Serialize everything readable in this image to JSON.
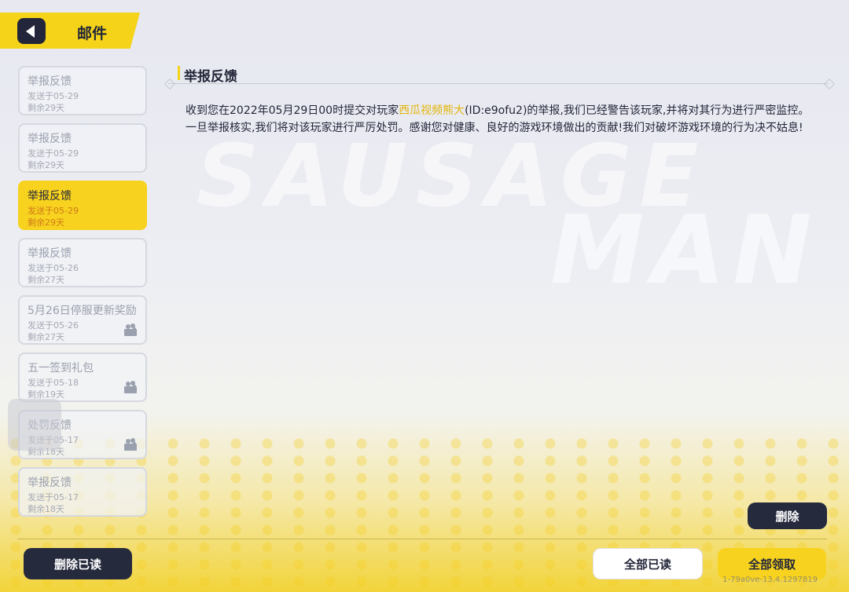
{
  "header": {
    "title": "邮件"
  },
  "background": {
    "watermark_line1": "SAUSAGE",
    "watermark_line2": "MAN"
  },
  "mail_list": [
    {
      "title": "举报反馈",
      "sent": "发送于05-29",
      "remaining": "剩余29天",
      "selected": false,
      "has_reward": false
    },
    {
      "title": "举报反馈",
      "sent": "发送于05-29",
      "remaining": "剩余29天",
      "selected": false,
      "has_reward": false
    },
    {
      "title": "举报反馈",
      "sent": "发送于05-29",
      "remaining": "剩余29天",
      "selected": true,
      "has_reward": false
    },
    {
      "title": "举报反馈",
      "sent": "发送于05-26",
      "remaining": "剩余27天",
      "selected": false,
      "has_reward": false
    },
    {
      "title": "5月26日停服更新奖励",
      "sent": "发送于05-26",
      "remaining": "剩余27天",
      "selected": false,
      "has_reward": true
    },
    {
      "title": "五一签到礼包",
      "sent": "发送于05-18",
      "remaining": "剩余19天",
      "selected": false,
      "has_reward": true
    },
    {
      "title": "处罚反馈",
      "sent": "发送于05-17",
      "remaining": "剩余18天",
      "selected": false,
      "has_reward": true
    },
    {
      "title": "举报反馈",
      "sent": "发送于05-17",
      "remaining": "剩余18天",
      "selected": false,
      "has_reward": false
    }
  ],
  "content": {
    "title": "举报反馈",
    "body_pre": "收到您在2022年05月29日00时提交对玩家",
    "body_highlight": "西瓜视频熊大",
    "body_post": "(ID:e9ofu2)的举报,我们已经警告该玩家,并将对其行为进行严密监控。一旦举报核实,我们将对该玩家进行严厉处罚。感谢您对健康、良好的游戏环境做出的贡献!我们对破坏游戏环境的行为决不姑息!"
  },
  "buttons": {
    "delete": "删除",
    "delete_read": "删除已读",
    "read_all": "全部已读",
    "claim_all": "全部领取"
  },
  "version": "1-79a0ve-13.4.1297819",
  "colors": {
    "accent": "#f7d21e",
    "dark": "#262a3d",
    "highlight": "#e2b40a"
  }
}
